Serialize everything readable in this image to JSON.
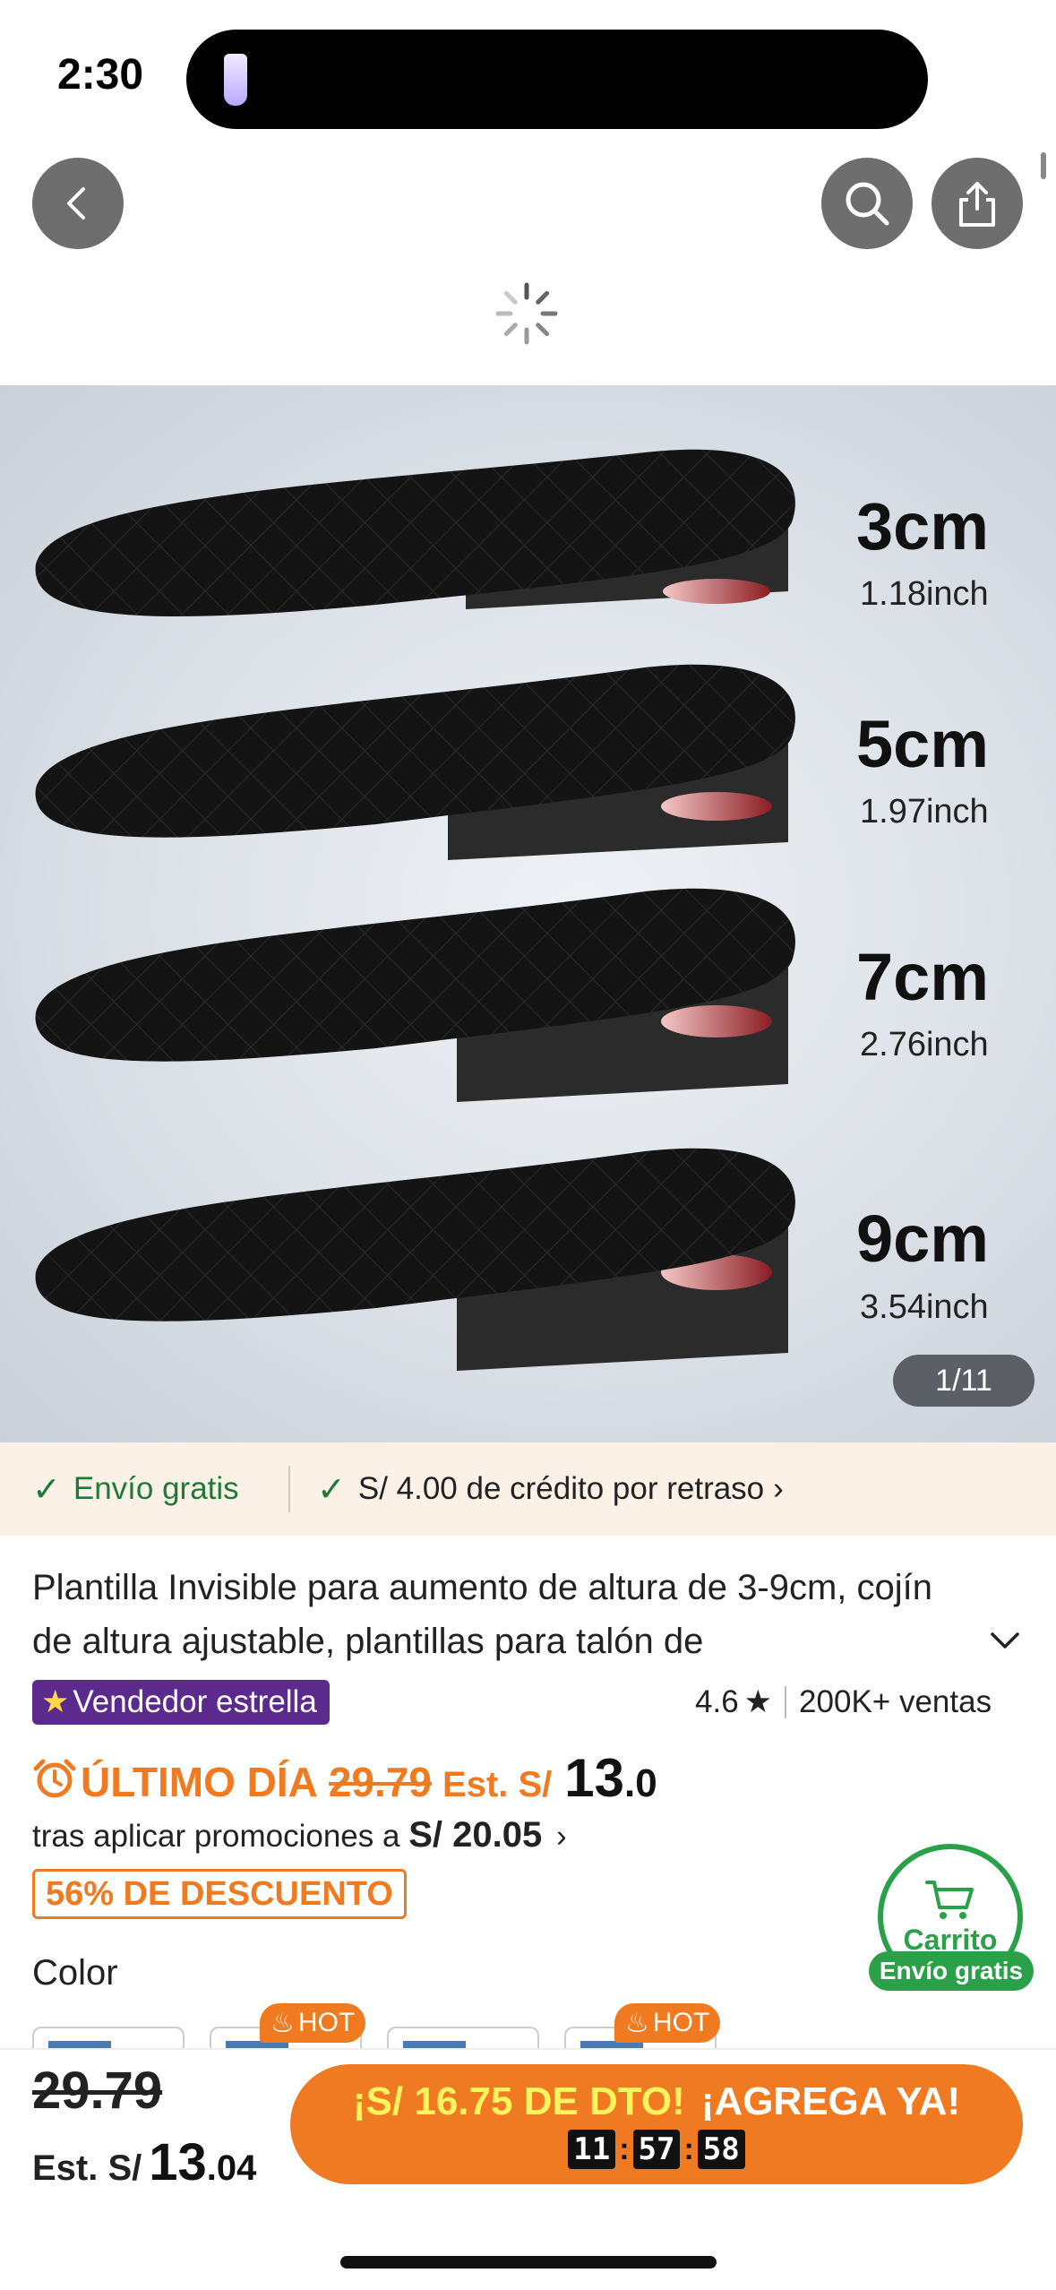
{
  "status": {
    "time": "2:30"
  },
  "nav": {
    "back_icon": "chevron-left-icon",
    "search_icon": "search-icon",
    "share_icon": "share-icon"
  },
  "gallery": {
    "sizes": [
      {
        "cm": "3cm",
        "inch": "1.18inch"
      },
      {
        "cm": "5cm",
        "inch": "1.97inch"
      },
      {
        "cm": "7cm",
        "inch": "2.76inch"
      },
      {
        "cm": "9cm",
        "inch": "3.54inch"
      }
    ],
    "pager": "1/11"
  },
  "shipping": {
    "free": "Envío gratis",
    "credit": "S/ 4.00 de crédito por retraso",
    "check_color": "#1f7a3a"
  },
  "product": {
    "title": "Plantilla Invisible para aumento de altura de 3-9cm, cojín de altura ajustable, plantillas para talón de",
    "seller_badge": "Vendedor estrella",
    "rating": "4.6",
    "sales": "200K+ ventas"
  },
  "pricing": {
    "deal_label": "ÚLTIMO DÍA",
    "old_price": "29.79",
    "est_label": "Est. S/",
    "price_int": "13",
    "price_cents": ".0",
    "promo_text": "tras aplicar promociones a",
    "promo_price": "S/ 20.05",
    "discount": "56% DE DESCUENTO",
    "accent": "#f07a20"
  },
  "color_section": {
    "label": "Color",
    "hot": "HOT"
  },
  "cart": {
    "label": "Carrito",
    "shipping": "Envío gratis",
    "accent": "#2aa048"
  },
  "bottom": {
    "old_price": "29.79",
    "est_label": "Est. S/",
    "price_int": "13",
    "price_cents": ".04",
    "cta_off": "¡S/ 16.75 DE DTO!",
    "cta_add": "¡AGREGA YA!",
    "timer": {
      "h": "11",
      "m": "57",
      "s": "58"
    }
  }
}
